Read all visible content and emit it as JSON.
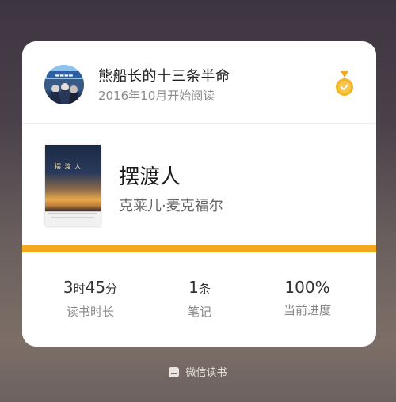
{
  "user": {
    "name": "熊船长的十三条半命",
    "start_text": "2016年10月开始阅读"
  },
  "book": {
    "title": "摆渡人",
    "author": "克莱儿·麦克福尔",
    "cover_text": "摆 渡 人"
  },
  "progress": {
    "percent": 100
  },
  "stats": {
    "time": {
      "hours": "3",
      "hours_unit": "时",
      "minutes": "45",
      "minutes_unit": "分",
      "label": "读书时长"
    },
    "notes": {
      "count": "1",
      "unit": "条",
      "label": "笔记"
    },
    "progress": {
      "value": "100%",
      "label": "当前进度"
    }
  },
  "footer": {
    "brand": "微信读书"
  },
  "icons": {
    "medal": "medal-icon",
    "app": "weread-icon"
  },
  "colors": {
    "accent": "#f3a81d",
    "medal": "#f0a81e"
  }
}
